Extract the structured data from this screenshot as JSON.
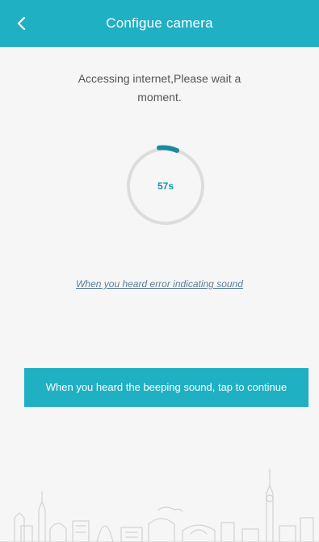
{
  "header": {
    "title": "Configue camera",
    "back_icon": "chevron-left-icon"
  },
  "status": {
    "message": "Accessing internet,Please wait a moment."
  },
  "progress": {
    "countdown_label": "57s",
    "remaining_seconds": 57,
    "ring_track_color": "#dcdcdc",
    "ring_active_color": "#1a8aa0"
  },
  "links": {
    "error_sound": "When you heard error indicating sound"
  },
  "actions": {
    "continue_label": "When you heard the beeping sound, tap to continue"
  },
  "theme": {
    "accent": "#1fb0c4",
    "background": "#f6f6f6"
  }
}
